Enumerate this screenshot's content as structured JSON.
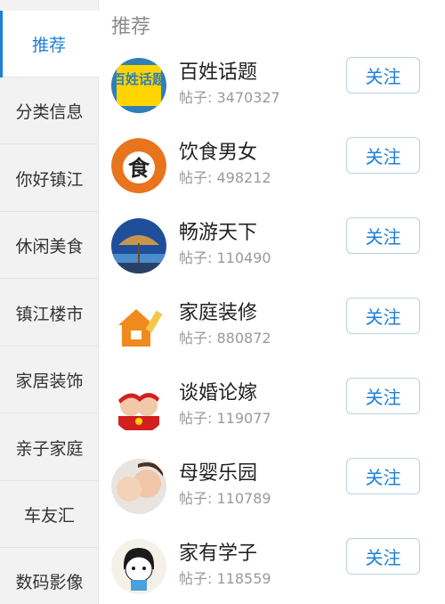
{
  "sidebar": {
    "items": [
      {
        "label": "推荐",
        "active": true
      },
      {
        "label": "分类信息"
      },
      {
        "label": "你好镇江"
      },
      {
        "label": "休闲美食"
      },
      {
        "label": "镇江楼市"
      },
      {
        "label": "家居装饰"
      },
      {
        "label": "亲子家庭"
      },
      {
        "label": "车友汇"
      },
      {
        "label": "数码影像"
      }
    ]
  },
  "main": {
    "section_title": "推荐",
    "follow_label": "关注",
    "forums": [
      {
        "name": "百姓话题",
        "posts": "帖子: 3470327",
        "avatar_icon": "baixing-huati-logo",
        "avatar_text": "百姓话题"
      },
      {
        "name": "饮食男女",
        "posts": "帖子: 498212",
        "avatar_icon": "food-logo",
        "avatar_text": "食"
      },
      {
        "name": "畅游天下",
        "posts": "帖子: 110490",
        "avatar_icon": "beach-umbrella-icon"
      },
      {
        "name": "家庭装修",
        "posts": "帖子: 880872",
        "avatar_icon": "house-paint-icon"
      },
      {
        "name": "谈婚论嫁",
        "posts": "帖子: 119077",
        "avatar_icon": "wedding-couple-icon"
      },
      {
        "name": "母婴乐园",
        "posts": "帖子: 110789",
        "avatar_icon": "mother-baby-icon"
      },
      {
        "name": "家有学子",
        "posts": "帖子: 118559",
        "avatar_icon": "student-cartoon-icon"
      }
    ]
  },
  "colors": {
    "accent": "#1e7fd6",
    "sidebar_bg": "#f2f2f2"
  }
}
